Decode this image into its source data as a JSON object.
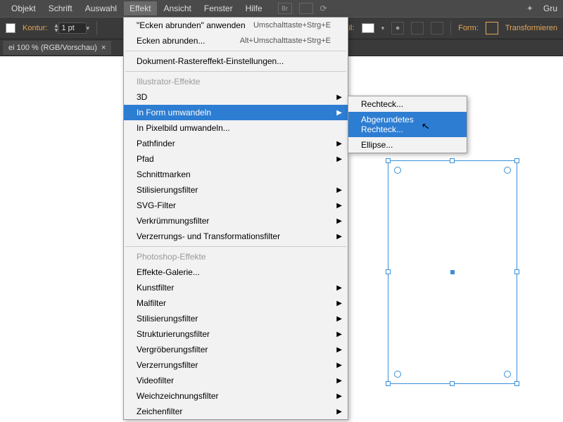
{
  "menubar": {
    "items": [
      "Objekt",
      "Schrift",
      "Auswahl",
      "Effekt",
      "Ansicht",
      "Fenster",
      "Hilfe"
    ],
    "active_index": 3,
    "right_label": "Gru"
  },
  "toolbar": {
    "kontur_label": "Kontur:",
    "kontur_value": "1 pt",
    "stil_label": "Stil:",
    "form_label": "Form:",
    "transform_label": "Transformieren"
  },
  "tab": {
    "title": "ei 100 % (RGB/Vorschau)",
    "close": "×"
  },
  "effekt_menu": {
    "top": [
      {
        "label": "\"Ecken abrunden\" anwenden",
        "shortcut": "Umschalttaste+Strg+E"
      },
      {
        "label": "Ecken abrunden...",
        "shortcut": "Alt+Umschalttaste+Strg+E"
      }
    ],
    "raster": "Dokument-Rastereffekt-Einstellungen...",
    "section_illustrator": "Illustrator-Effekte",
    "illustrator_items": [
      {
        "label": "3D",
        "arrow": true
      },
      {
        "label": "In Form umwandeln",
        "arrow": true,
        "selected": true
      },
      {
        "label": "In Pixelbild umwandeln..."
      },
      {
        "label": "Pathfinder",
        "arrow": true
      },
      {
        "label": "Pfad",
        "arrow": true
      },
      {
        "label": "Schnittmarken"
      },
      {
        "label": "Stilisierungsfilter",
        "arrow": true
      },
      {
        "label": "SVG-Filter",
        "arrow": true
      },
      {
        "label": "Verkrümmungsfilter",
        "arrow": true
      },
      {
        "label": "Verzerrungs- und Transformationsfilter",
        "arrow": true
      }
    ],
    "section_photoshop": "Photoshop-Effekte",
    "photoshop_items": [
      "Effekte-Galerie...",
      "Kunstfilter",
      "Malfilter",
      "Stilisierungsfilter",
      "Strukturierungsfilter",
      "Vergröberungsfilter",
      "Verzerrungsfilter",
      "Videofilter",
      "Weichzeichnungsfilter",
      "Zeichenfilter"
    ]
  },
  "submenu": {
    "items": [
      "Rechteck...",
      "Abgerundetes Rechteck...",
      "Ellipse..."
    ],
    "selected_index": 1
  }
}
